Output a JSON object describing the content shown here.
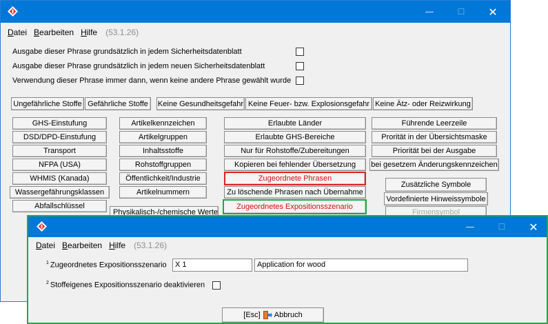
{
  "main_window": {
    "menu": [
      "Datei",
      "Bearbeiten",
      "Hilfe"
    ],
    "version": "(53.1.26)",
    "checks": [
      "Ausgabe dieser Phrase grundsätzlich in jedem Sicherheitsdatenblatt",
      "Ausgabe dieser Phrase grundsätzlich in jedem neuen Sicherheitsdatenblatt",
      "Verwendung dieser Phrase immer dann, wenn keine andere Phrase gewählt wurde"
    ],
    "row_buttons": [
      "Ungefährliche Stoffe",
      "Gefährliche Stoffe",
      "Keine Gesundheitsgefahr",
      "Keine Feuer- bzw. Explosionsgefahr",
      "Keine Ätz- oder Reizwirkung"
    ],
    "col1": [
      "GHS-Einstufung",
      "DSD/DPD-Einstufung",
      "Transport",
      "NFPA (USA)",
      "WHMIS (Kanada)",
      "Wassergefährungsklassen",
      "Abfallschlüssel"
    ],
    "col2": [
      "Artikelkennzeichen",
      "Artikelgruppen",
      "Inhaltsstoffe",
      "Rohstoffgruppen",
      "Öffentlichkeit/Industrie",
      "Artikelnummern"
    ],
    "col2_extra": "Physikalisch-/chemische Werte",
    "col3": [
      "Erlaubte Länder",
      "Erlaubte GHS-Bereiche",
      "Nur für Rohstoffe/Zubereitungen",
      "Kopieren bei fehlender Übersetzung",
      "Zugeordnete Phrasen",
      "Zu löschende Phrasen nach Übernahme",
      "Zugeordnetes Expositionsszenario"
    ],
    "col4": [
      "Führende Leerzeile",
      "Prorität in der Übersichtsmaske",
      "Priorität bei der Ausgabe",
      "bei gesetzem Änderungskennzeichen"
    ],
    "col5": [
      "Zusätzliche Symbole",
      "Vordefinierte Hinweissymbole",
      "Firmensymbol"
    ]
  },
  "dialog": {
    "menu": [
      "Datei",
      "Bearbeiten",
      "Hilfe"
    ],
    "version": "(53.1.26)",
    "field1_sup": "1",
    "field1_label": "Zugeordnetes Expositionsszenario",
    "field1_code": "X 1",
    "field1_desc": "Application for wood",
    "field2_sup": "2",
    "field2_label": "Stoffeigenes Expositionsszenario deaktivieren",
    "cancel_key": "[Esc]",
    "cancel_label": "Abbruch"
  },
  "colors": {
    "titlebar": "#0078d7",
    "highlight_red": "#e02020",
    "highlight_green": "#20a83a"
  }
}
